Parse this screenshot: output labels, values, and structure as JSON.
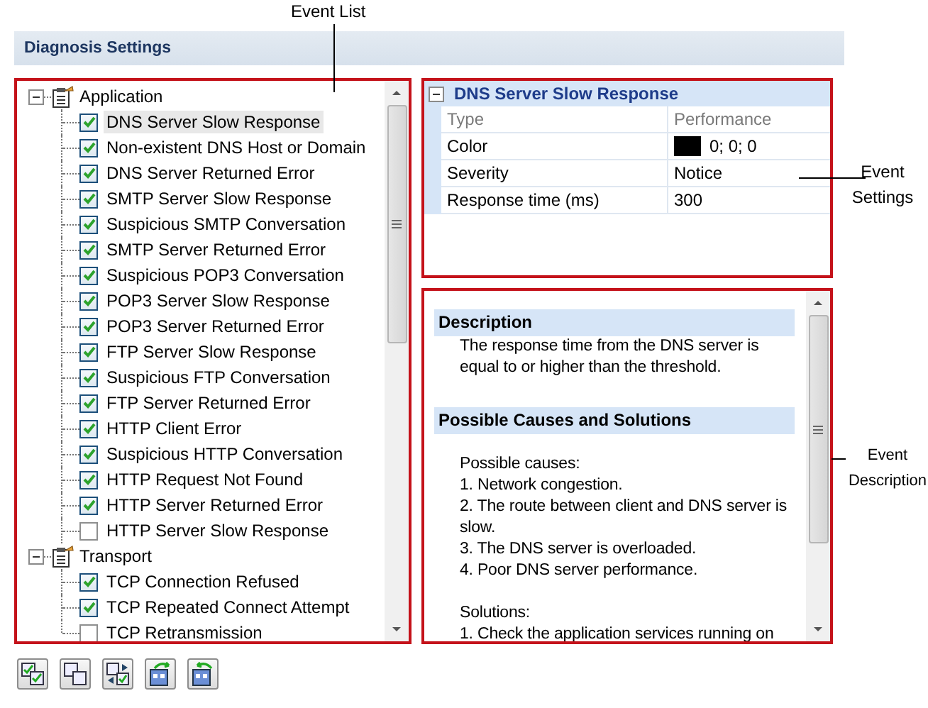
{
  "callouts": {
    "event_list": "Event List",
    "event_settings": "Event Settings",
    "event_description": "Event Description"
  },
  "header": {
    "title": "Diagnosis Settings"
  },
  "event_tree": [
    {
      "label": "Application",
      "expanded": true,
      "children": [
        {
          "label": "DNS Server Slow Response",
          "checked": true,
          "selected": true
        },
        {
          "label": "Non-existent DNS Host or Domain",
          "checked": true,
          "selected": false
        },
        {
          "label": "DNS Server Returned Error",
          "checked": true,
          "selected": false
        },
        {
          "label": "SMTP Server Slow Response",
          "checked": true,
          "selected": false
        },
        {
          "label": "Suspicious SMTP Conversation",
          "checked": true,
          "selected": false
        },
        {
          "label": "SMTP Server Returned Error",
          "checked": true,
          "selected": false
        },
        {
          "label": "Suspicious POP3 Conversation",
          "checked": true,
          "selected": false
        },
        {
          "label": "POP3 Server Slow Response",
          "checked": true,
          "selected": false
        },
        {
          "label": "POP3 Server Returned Error",
          "checked": true,
          "selected": false
        },
        {
          "label": "FTP Server Slow Response",
          "checked": true,
          "selected": false
        },
        {
          "label": "Suspicious FTP Conversation",
          "checked": true,
          "selected": false
        },
        {
          "label": "FTP Server Returned Error",
          "checked": true,
          "selected": false
        },
        {
          "label": "HTTP Client Error",
          "checked": true,
          "selected": false
        },
        {
          "label": "Suspicious HTTP Conversation",
          "checked": true,
          "selected": false
        },
        {
          "label": "HTTP Request Not Found",
          "checked": true,
          "selected": false
        },
        {
          "label": "HTTP Server Returned Error",
          "checked": true,
          "selected": false
        },
        {
          "label": "HTTP Server Slow Response",
          "checked": false,
          "selected": false
        }
      ]
    },
    {
      "label": "Transport",
      "expanded": true,
      "children": [
        {
          "label": "TCP Connection Refused",
          "checked": true,
          "selected": false
        },
        {
          "label": "TCP Repeated Connect Attempt",
          "checked": true,
          "selected": false
        },
        {
          "label": "TCP Retransmission",
          "checked": false,
          "selected": false
        }
      ]
    }
  ],
  "settings": {
    "title": "DNS Server Slow Response",
    "expanded": true,
    "rows": [
      {
        "name": "Type",
        "value": "Performance",
        "disabled": true
      },
      {
        "name": "Color",
        "value": "0; 0; 0",
        "color": "#000000",
        "disabled": false
      },
      {
        "name": "Severity",
        "value": "Notice",
        "disabled": false
      },
      {
        "name": "Response time (ms)",
        "value": "300",
        "disabled": false
      }
    ]
  },
  "description": {
    "sections": [
      {
        "title": "Description",
        "blocks": [
          [
            "The response time from the DNS server is equal to or higher than the threshold."
          ]
        ]
      },
      {
        "title": "Possible Causes and Solutions",
        "blocks": [
          [
            "Possible causes:",
            "1. Network congestion.",
            "2. The route between client and DNS server is slow.",
            "3. The DNS server is overloaded.",
            "4. Poor DNS server performance."
          ],
          [
            "Solutions:",
            "1. Check the application services running on"
          ]
        ]
      }
    ]
  },
  "toolbar": [
    {
      "kind": "check-all"
    },
    {
      "kind": "uncheck-all"
    },
    {
      "kind": "invert"
    },
    {
      "kind": "import"
    },
    {
      "kind": "export"
    }
  ]
}
